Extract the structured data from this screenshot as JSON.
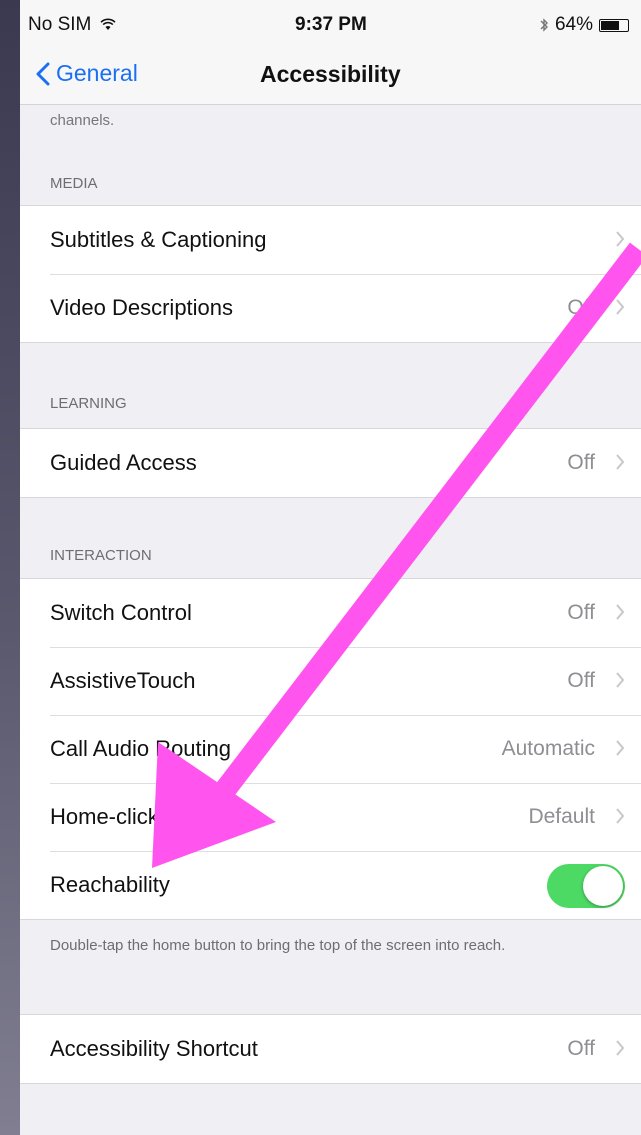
{
  "status_bar": {
    "carrier": "No SIM",
    "wifi_icon": "wifi-icon",
    "time": "9:37 PM",
    "bluetooth_icon": "bluetooth-icon",
    "battery_percent": "64%",
    "battery_level": 0.64
  },
  "nav": {
    "back_label": "General",
    "title": "Accessibility"
  },
  "top_footnote": "channels.",
  "sections": {
    "media": {
      "header": "MEDIA",
      "rows": [
        {
          "label": "Subtitles & Captioning",
          "value": ""
        },
        {
          "label": "Video Descriptions",
          "value": "Off"
        }
      ]
    },
    "learning": {
      "header": "LEARNING",
      "rows": [
        {
          "label": "Guided Access",
          "value": "Off"
        }
      ]
    },
    "interaction": {
      "header": "INTERACTION",
      "rows": [
        {
          "label": "Switch Control",
          "value": "Off"
        },
        {
          "label": "AssistiveTouch",
          "value": "Off"
        },
        {
          "label": "Call Audio Routing",
          "value": "Automatic"
        },
        {
          "label": "Home-click Speed",
          "value": "Default"
        },
        {
          "label": "Reachability",
          "toggle": true
        }
      ],
      "footer": "Double-tap the home button to bring the top of the screen into reach."
    },
    "shortcut": {
      "rows": [
        {
          "label": "Accessibility Shortcut",
          "value": "Off"
        }
      ]
    }
  },
  "colors": {
    "accent": "#1a6ff2",
    "toggle_on": "#4cd964",
    "annotation_arrow": "#ff55ee"
  }
}
